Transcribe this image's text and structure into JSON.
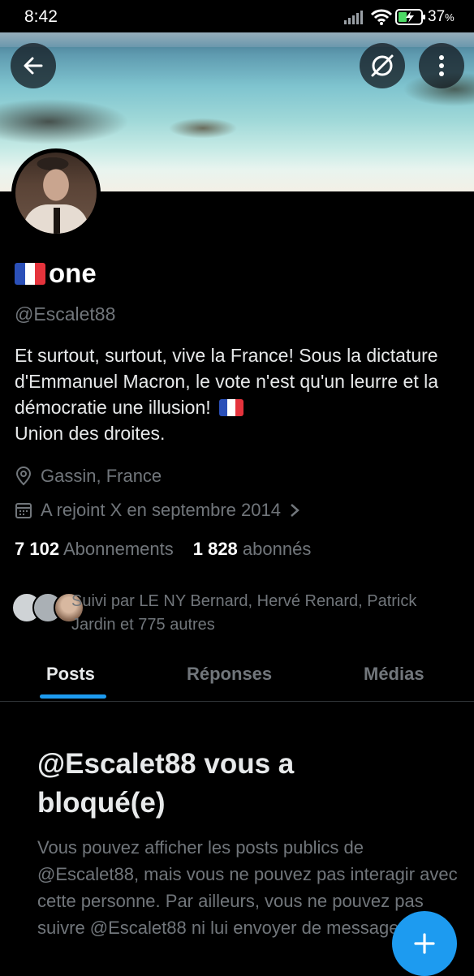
{
  "status_bar": {
    "time": "8:42",
    "battery_percent": "37",
    "battery_unit": "%"
  },
  "header": {
    "back_icon": "arrow-left-icon",
    "grok_icon": "grok-slash-circle-icon",
    "more_icon": "vertical-dots-icon"
  },
  "profile": {
    "name": "one",
    "handle": "@Escalet88",
    "bio": "Et surtout, surtout, vive la France! Sous la dictature d'Emmanuel Macron, le vote n'est qu'un leurre et la démocratie une illusion!",
    "bio_end": "Union des droites.",
    "location": "Gassin, France",
    "joined": "A rejoint X en septembre 2014",
    "following_count": "7 102",
    "following_label": "Abonnements",
    "followers_count": "1 828",
    "followers_label": "abonnés",
    "followed_by": "Suivi par LE NY Bernard, Hervé Renard, Patrick Jardin et 775 autres"
  },
  "tabs": [
    {
      "label": "Posts",
      "active": true
    },
    {
      "label": "Réponses",
      "active": false
    },
    {
      "label": "Médias",
      "active": false
    }
  ],
  "blocked": {
    "title": "@Escalet88 vous a bloqué(e)",
    "message": "Vous pouvez afficher les posts publics de @Escalet88, mais vous ne pouvez pas interagir avec cette personne. Par ailleurs, vous ne pouvez pas suivre @Escalet88 ni lui envoyer de messages."
  },
  "colors": {
    "accent": "#1d9bf0",
    "background": "#000000",
    "muted": "#71767b"
  }
}
